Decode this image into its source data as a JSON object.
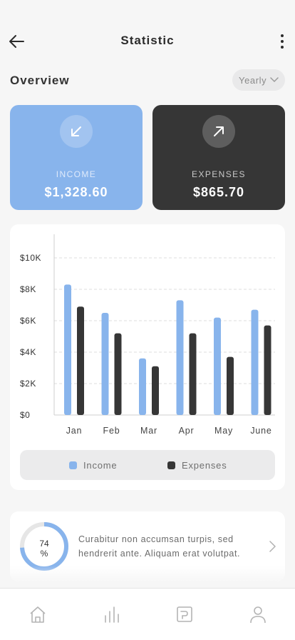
{
  "header": {
    "title": "Statistic"
  },
  "overview": {
    "title": "Overview",
    "period": "Yearly"
  },
  "cards": {
    "income": {
      "label": "INCOME",
      "amount": "$1,328.60"
    },
    "expenses": {
      "label": "EXPENSES",
      "amount": "$865.70"
    }
  },
  "colors": {
    "income": "#88b4ec",
    "expenses": "#363636",
    "background": "#f6f6f6"
  },
  "chart_data": {
    "type": "bar",
    "categories": [
      "Jan",
      "Feb",
      "Mar",
      "Apr",
      "May",
      "June"
    ],
    "series": [
      {
        "name": "Income",
        "values": [
          8300,
          6500,
          3600,
          7300,
          6200,
          6700
        ]
      },
      {
        "name": "Expenses",
        "values": [
          6900,
          5200,
          3100,
          5200,
          3700,
          5700
        ]
      }
    ],
    "ytick_labels": [
      "$0",
      "$2K",
      "$4K",
      "$6K",
      "$8K",
      "$10K"
    ],
    "ytick_values": [
      0,
      2000,
      4000,
      6000,
      8000,
      10000
    ],
    "ylim": [
      0,
      10000
    ],
    "grid": true,
    "legend_position": "bottom"
  },
  "legend": {
    "income": "Income",
    "expenses": "Expenses"
  },
  "tip": {
    "percent": 74,
    "percent_label": "74",
    "percent_unit": "%",
    "text": "Curabitur non accumsan turpis, sed hendrerit ante. Aliquam erat volutpat."
  },
  "nav": {
    "icons": [
      "home-icon",
      "stats-icon",
      "wallet-icon",
      "profile-icon"
    ]
  }
}
